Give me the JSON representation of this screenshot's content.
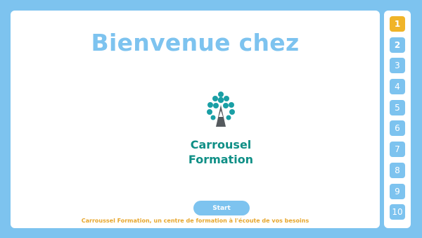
{
  "main": {
    "title": "Bienvenue chez",
    "brand_line1": "Carrousel",
    "brand_line2": "Formation",
    "start_label": "Start",
    "tagline": "Carroussel Formation, un centre de formation à l'écoute de vos besoins"
  },
  "sidebar": {
    "pages": [
      {
        "label": "1",
        "state": "active"
      },
      {
        "label": "2",
        "state": "visited"
      },
      {
        "label": "3",
        "state": "normal"
      },
      {
        "label": "4",
        "state": "normal"
      },
      {
        "label": "5",
        "state": "normal"
      },
      {
        "label": "6",
        "state": "normal"
      },
      {
        "label": "7",
        "state": "normal"
      },
      {
        "label": "8",
        "state": "normal"
      },
      {
        "label": "9",
        "state": "normal"
      },
      {
        "label": "10",
        "state": "normal"
      }
    ]
  },
  "colors": {
    "background": "#7dc3ef",
    "brand": "#0f8f86",
    "active_page": "#f0b429",
    "tagline": "#e7a62c"
  },
  "icons": {
    "logo": "tree-logo-icon"
  }
}
